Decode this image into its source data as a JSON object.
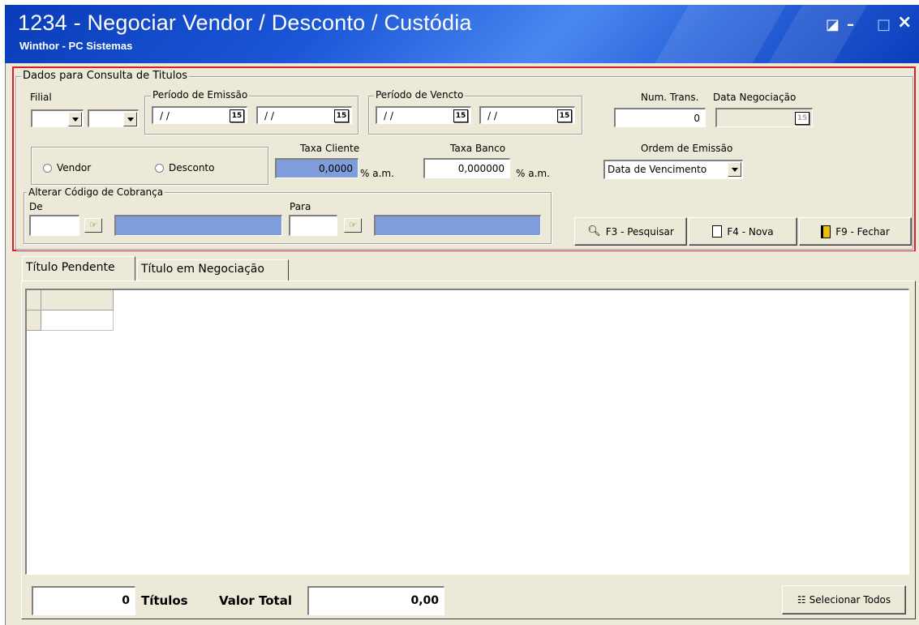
{
  "window": {
    "title": "1234 - Negociar Vendor / Desconto / Custódia",
    "subtitle": "Winthor - PC Sistemas",
    "controls": {
      "restore": "◪",
      "minimize": "–",
      "maximize": "□",
      "close": "×"
    }
  },
  "filter": {
    "legend": "Dados para Consulta de Titulos",
    "filial_label": "Filial",
    "emissao_legend": "Período de Emissão",
    "emissao_start": "/ /",
    "emissao_end": "/ /",
    "vencto_legend": "Período de Vencto",
    "vencto_start": "/ /",
    "vencto_end": "/ /",
    "calendar_glyph": "15",
    "num_trans_label": "Num. Trans.",
    "num_trans_value": "0",
    "data_negociacao_label": "Data Negociação",
    "vendor_label": "Vendor",
    "desconto_label": "Desconto",
    "taxa_cliente_label": "Taxa Cliente",
    "taxa_cliente_value": "0,0000",
    "taxa_cliente_unit": "% a.m.",
    "taxa_banco_label": "Taxa Banco",
    "taxa_banco_value": "0,000000",
    "taxa_banco_unit": "% a.m.",
    "ordem_label": "Ordem de Emissão",
    "ordem_value": "Data de Vencimento",
    "cobranca_legend": "Alterar Código de Cobrança",
    "de_label": "De",
    "para_label": "Para"
  },
  "actions": {
    "pesquisar": "F3 - Pesquisar",
    "nova": "F4 - Nova",
    "fechar": "F9 - Fechar"
  },
  "tabs": [
    {
      "label": "Título Pendente",
      "active": true
    },
    {
      "label": "Título em Negociação",
      "active": false
    }
  ],
  "footer": {
    "count_value": "0",
    "titulos_label": "Títulos",
    "valor_total_label": "Valor Total",
    "valor_total_value": "0,00",
    "selecionar_todos": "Selecionar Todos"
  },
  "colors": {
    "title_bar": "#1b57d8",
    "highlight_border": "#e02020",
    "readonly_field": "#7f9ddb",
    "panel": "#ece9d8"
  }
}
